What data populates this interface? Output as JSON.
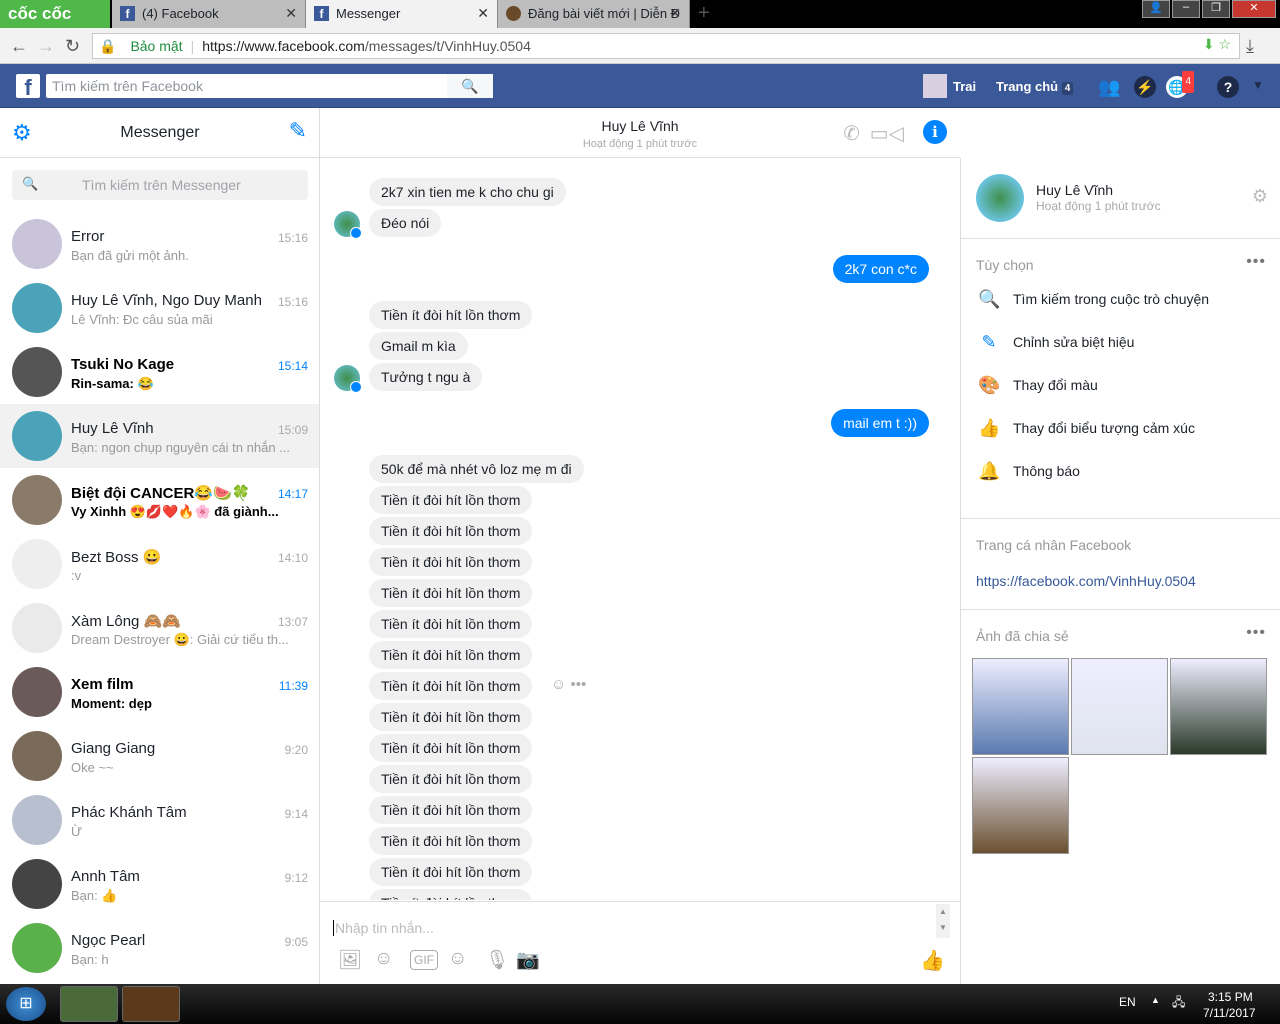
{
  "browser": {
    "brand": "cốc cốc",
    "tabs": [
      {
        "label": "(4) Facebook",
        "active": false
      },
      {
        "label": "Messenger",
        "active": true
      },
      {
        "label": "Đăng bài viết mới | Diễn Đ",
        "active": false
      }
    ],
    "secure_label": "Bảo mật",
    "url_host": "https://www.facebook.com",
    "url_path": "/messages/t/VinhHuy.0504"
  },
  "fb": {
    "search_placeholder": "Tìm kiếm trên Facebook",
    "profile_name": "Trai",
    "home_label": "Trang chủ",
    "home_count": "4",
    "notif_count": "4"
  },
  "sidebar": {
    "title": "Messenger",
    "search_placeholder": "Tìm kiếm trên Messenger",
    "conversations": [
      {
        "name": "Error",
        "snippet": "Bạn đã gửi một ảnh.",
        "time": "15:16",
        "unread": false,
        "color": "#c9c4da"
      },
      {
        "name": "Huy Lê Vĩnh, Ngo Duy Manh",
        "snippet": "Lê Vĩnh: Đc câu sủa mãi",
        "time": "15:16",
        "unread": false,
        "color": "#4aa3b8"
      },
      {
        "name": "Tsuki No Kage",
        "snippet": "Rin-sama: 😂",
        "time": "15:14",
        "unread": true,
        "color": "#555"
      },
      {
        "name": "Huy Lê Vĩnh",
        "snippet": "Bạn: ngon chụp nguyên cái tn nhắn ...",
        "time": "15:09",
        "unread": false,
        "selected": true,
        "color": "#4aa3b8"
      },
      {
        "name": "Biệt đội CANCER😂🍉🍀",
        "snippet": "Vy Xinhh 😍💋❤️🔥🌸 đã giành...",
        "time": "14:17",
        "unread": true,
        "color": "#8a7a6a"
      },
      {
        "name": "Bezt Boss 😀",
        "snippet": ":v",
        "time": "14:10",
        "unread": false,
        "color": "#eee"
      },
      {
        "name": "Xàm Lông 🙈🙈",
        "snippet": "Dream Destroyer 😀: Giải cứ tiểu th...",
        "time": "13:07",
        "unread": false,
        "color": "#eaeaea"
      },
      {
        "name": "Xem film",
        "snippet": "Moment: dẹp",
        "time": "11:39",
        "unread": true,
        "color": "#6b5a5a"
      },
      {
        "name": "Giang Giang",
        "snippet": "Oke ~~",
        "time": "9:20",
        "unread": false,
        "color": "#7a6a5a"
      },
      {
        "name": "Phác Khánh Tâm",
        "snippet": "Ừ",
        "time": "9:14",
        "unread": false,
        "color": "#b8c0d0"
      },
      {
        "name": "Annh Tâm",
        "snippet": "Bạn: 👍",
        "time": "9:12",
        "unread": false,
        "color": "#444"
      },
      {
        "name": "Ngọc Pearl",
        "snippet": "Bạn: h",
        "time": "9:05",
        "unread": false,
        "color": "#5ab04a"
      }
    ]
  },
  "chat": {
    "name": "Huy Lê Vĩnh",
    "status": "Hoạt động 1 phút trước",
    "input_placeholder": "Nhập tin nhắn...",
    "messages": [
      {
        "from": "them",
        "text": "2k7 xin tien me k cho chu gi",
        "gap": false
      },
      {
        "from": "them",
        "text": "Đéo nói",
        "avatar": true
      },
      {
        "from": "me",
        "text": "2k7 con c*c",
        "gap": true
      },
      {
        "from": "them",
        "text": "Tiền ít đòi hít lồn thơm",
        "gap": true
      },
      {
        "from": "them",
        "text": "Gmail m kìa"
      },
      {
        "from": "them",
        "text": "Tưởng t ngu à",
        "avatar": true
      },
      {
        "from": "me",
        "text": "mail em t :))",
        "gap": true
      },
      {
        "from": "them",
        "text": "50k để mà nhét vô loz mẹ m đi",
        "gap": true
      },
      {
        "from": "them",
        "text": "Tiền ít đòi hít lồn thơm"
      },
      {
        "from": "them",
        "text": "Tiền ít đòi hít lồn thơm"
      },
      {
        "from": "them",
        "text": "Tiền ít đòi hít lồn thơm"
      },
      {
        "from": "them",
        "text": "Tiền ít đòi hít lồn thơm"
      },
      {
        "from": "them",
        "text": "Tiền ít đòi hít lồn thơm"
      },
      {
        "from": "them",
        "text": "Tiền ít đòi hít lồn thơm"
      },
      {
        "from": "them",
        "text": "Tiền ít đòi hít lồn thơm",
        "hover": true
      },
      {
        "from": "them",
        "text": "Tiền ít đòi hít lồn thơm"
      },
      {
        "from": "them",
        "text": "Tiền ít đòi hít lồn thơm"
      },
      {
        "from": "them",
        "text": "Tiền ít đòi hít lồn thơm"
      },
      {
        "from": "them",
        "text": "Tiền ít đòi hít lồn thơm"
      },
      {
        "from": "them",
        "text": "Tiền ít đòi hít lồn thơm"
      },
      {
        "from": "them",
        "text": "Tiền ít đòi hít lồn thơm"
      },
      {
        "from": "them",
        "text": "Tiền ít đòi hít lồn thơm"
      }
    ]
  },
  "details": {
    "name": "Huy Lê Vĩnh",
    "status": "Hoạt động 1 phút trước",
    "options_header": "Tùy chọn",
    "options": [
      {
        "label": "Tìm kiếm trong cuộc trò chuyện",
        "icon": "🔍"
      },
      {
        "label": "Chỉnh sửa biệt hiệu",
        "icon": "✎"
      },
      {
        "label": "Thay đổi màu",
        "icon": "🎨"
      },
      {
        "label": "Thay đổi biểu tượng cảm xúc",
        "icon": "👍"
      },
      {
        "label": "Thông báo",
        "icon": "🔔"
      }
    ],
    "profile_header": "Trang cá nhân Facebook",
    "profile_link": "https://facebook.com/VinhHuy.0504",
    "photos_header": "Ảnh đã chia sẻ",
    "photo_count": 4
  },
  "taskbar": {
    "lang": "EN",
    "time": "3:15 PM",
    "date": "7/11/2017"
  },
  "colors": {
    "accent": "#0084ff",
    "fb_blue": "#3b5998"
  }
}
